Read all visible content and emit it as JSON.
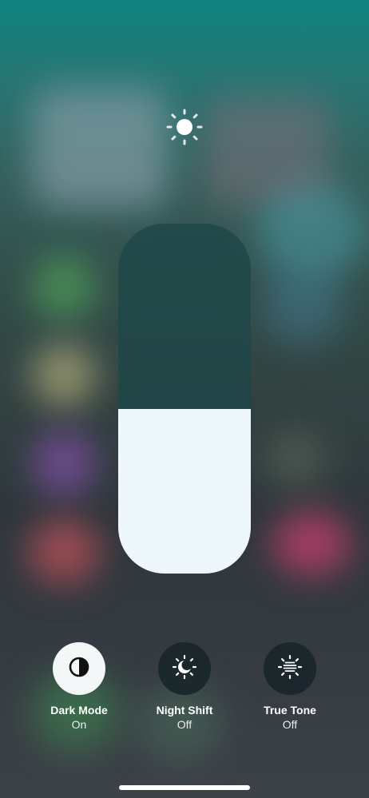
{
  "brightness": {
    "icon": "sun-icon",
    "level_fraction": 0.47
  },
  "controls": [
    {
      "label": "Dark Mode",
      "status": "On",
      "icon": "dark-mode-icon",
      "active": true
    },
    {
      "label": "Night Shift",
      "status": "Off",
      "icon": "night-shift-icon",
      "active": false
    },
    {
      "label": "True Tone",
      "status": "Off",
      "icon": "true-tone-icon",
      "active": false
    }
  ],
  "colors": {
    "slider_fill": "#eef7fb",
    "slider_track": "#1e4648",
    "button_on": "#f4f7f8",
    "button_off": "#19262a"
  }
}
